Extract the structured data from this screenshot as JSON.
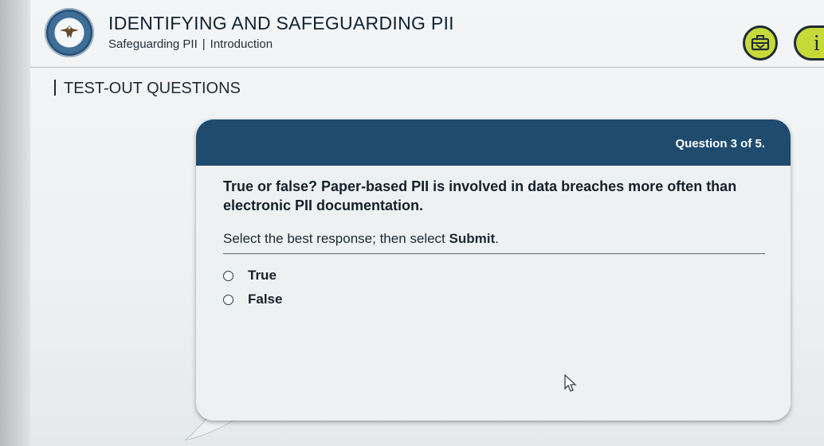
{
  "header": {
    "course_title": "IDENTIFYING AND SAFEGUARDING PII",
    "breadcrumb": {
      "section": "Safeguarding PII",
      "separator": "|",
      "page": "Introduction"
    },
    "seal_icon": "dod-seal-icon",
    "toolbox_icon": "toolbox-icon",
    "info_icon": "info-icon",
    "info_glyph": "i",
    "accent_color": "#c8da3a"
  },
  "section": {
    "title": "TEST-OUT QUESTIONS"
  },
  "question_card": {
    "counter": "Question 3 of 5.",
    "question_text": "True or false? Paper-based PII is involved in data breaches more often than electronic PII documentation.",
    "instruction_prefix": "Select the best response; then select ",
    "instruction_emphasis": "Submit",
    "instruction_suffix": ".",
    "options": [
      {
        "label": "True",
        "selected": false
      },
      {
        "label": "False",
        "selected": false
      }
    ],
    "header_color": "#1f4b6e"
  }
}
